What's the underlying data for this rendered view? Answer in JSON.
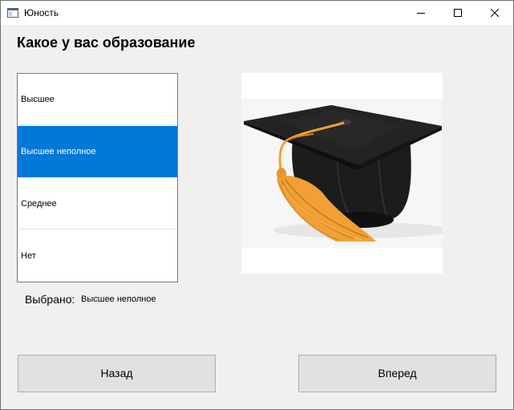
{
  "window": {
    "title": "Юность"
  },
  "heading": "Какое у вас образование",
  "list": {
    "items": [
      {
        "label": "Высшее"
      },
      {
        "label": "Высшее неполное"
      },
      {
        "label": "Среднее"
      },
      {
        "label": "Нет"
      }
    ],
    "selected_index": 1
  },
  "selection": {
    "label": "Выбрано:",
    "value": "Высшее неполное"
  },
  "buttons": {
    "back_label": "Назад",
    "next_label": "Вперед"
  },
  "picture": {
    "subject": "graduation-cap-icon"
  },
  "colors": {
    "selection": "#0078d7",
    "window_bg": "#f0f0f0",
    "button_bg": "#e1e1e1",
    "tassel": "#f0a035"
  }
}
